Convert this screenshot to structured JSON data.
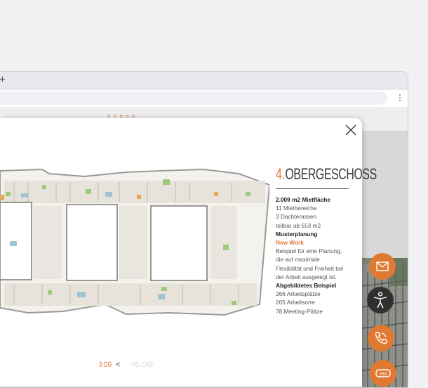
{
  "browser": {
    "new_tab_glyph": "+",
    "menu_glyph": "⋮"
  },
  "modal": {
    "title_number": "4.",
    "title_text": "OBERGESCHOSS",
    "info": [
      {
        "text": "2.009 m2 Mietfläche",
        "style": "b"
      },
      {
        "text": "11 Mietbereiche",
        "style": ""
      },
      {
        "text": "3 Dachterassen",
        "style": ""
      },
      {
        "text": "teilbar ab 553 m2",
        "style": ""
      },
      {
        "text": "Musterplanung",
        "style": "b"
      },
      {
        "text": "New Work",
        "style": "o"
      },
      {
        "text": "Beispiel für eine Planung,",
        "style": ""
      },
      {
        "text": "die auf maximale",
        "style": ""
      },
      {
        "text": "Flexibilität und Freiheit bei",
        "style": ""
      },
      {
        "text": "der Arbeit ausgelegt ist.",
        "style": ""
      },
      {
        "text": "Abgebildetes Beispiel",
        "style": "b"
      },
      {
        "text": "266 Arbeitsplätze",
        "style": ""
      },
      {
        "text": "205 Arbeitsorte",
        "style": ""
      },
      {
        "text": "78 Meeting-Plätze",
        "style": ""
      }
    ],
    "pager": {
      "current": "3.OG",
      "prev_glyph": "<",
      "next_glyph": ">",
      "next": "5.OG"
    }
  },
  "icons": {
    "close": "close-icon",
    "mail": "mail-icon",
    "accessibility": "accessibility-icon",
    "phone": "phone-icon",
    "view360": "360-view-icon"
  },
  "colors": {
    "accent": "#e07a33",
    "dark": "#2f3130",
    "text": "#555555"
  }
}
